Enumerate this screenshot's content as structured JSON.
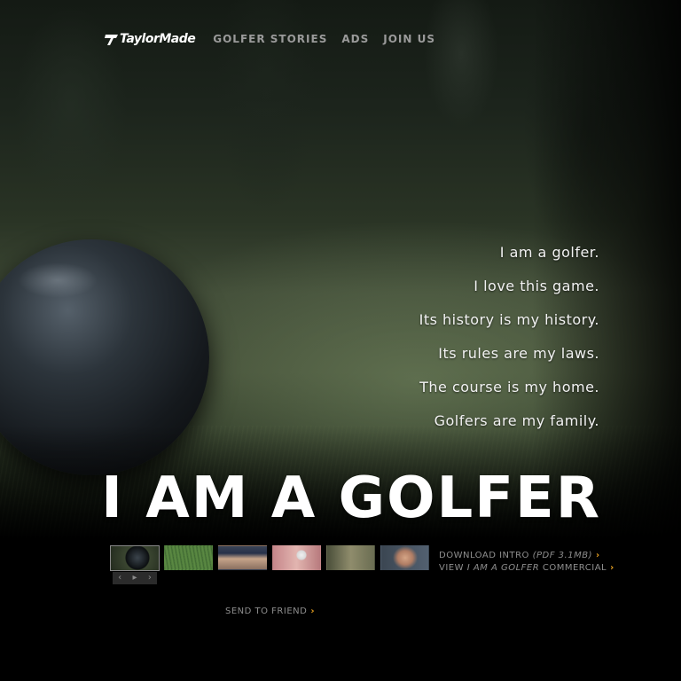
{
  "brand": {
    "logo_text": "TaylorMade",
    "logo_icon": "taylormade-t-icon"
  },
  "nav": {
    "items": [
      {
        "label": "GOLFER STORIES"
      },
      {
        "label": "ADS"
      },
      {
        "label": "JOIN US"
      }
    ]
  },
  "creed": {
    "lines": [
      "I am a golfer.",
      "I love this game.",
      "Its history is my history.",
      "Its rules are my laws.",
      "The course is my home.",
      "Golfers are my family."
    ]
  },
  "headline": "I AM A GOLFER",
  "gallery": {
    "thumbnails": [
      {
        "subject": "golf ball on grass"
      },
      {
        "subject": "grass close-up"
      },
      {
        "subject": "golfer in cap"
      },
      {
        "subject": "ball on tee"
      },
      {
        "subject": "golfer swinging"
      },
      {
        "subject": "young golfer"
      }
    ],
    "active_index": 0,
    "pager": {
      "prev": "‹",
      "play": "▸",
      "next": "›"
    }
  },
  "links": {
    "download_prefix": "DOWNLOAD INTRO ",
    "download_meta": "(PDF 3.1MB)",
    "view_prefix": "VIEW ",
    "view_italic": "I AM A GOLFER",
    "view_suffix": " COMMERCIAL",
    "send_friend": "SEND TO FRIEND",
    "chevron": "›"
  },
  "colors": {
    "accent": "#e8a020",
    "nav_text": "#9a9a9a",
    "link_text": "#8e8e8e",
    "background": "#000000"
  }
}
